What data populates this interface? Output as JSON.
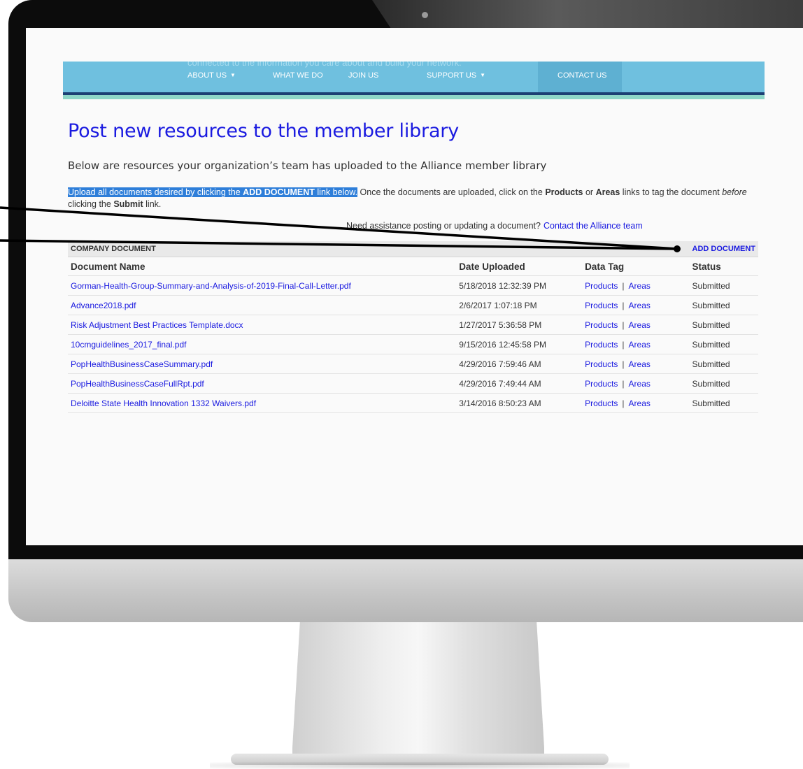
{
  "nav": {
    "tagline": "connected to the information you care about and build your network.",
    "items": [
      {
        "label": "ABOUT US",
        "arrow": "▼"
      },
      {
        "label": "WHAT WE DO"
      },
      {
        "label": "JOIN US"
      },
      {
        "label": "SUPPORT US",
        "arrow": "▼"
      },
      {
        "label": "CONTACT US"
      }
    ]
  },
  "page": {
    "title": "Post new resources to the member library",
    "subtitle": "Below are resources your organization’s team has uploaded to the Alliance member library",
    "instructions": {
      "highlight_pre": "Upload all documents desired by clicking the ",
      "highlight_bold": "ADD DOCUMENT",
      "highlight_post": " link below.",
      "text1": " Once the documents are uploaded, click on the ",
      "products": "Products",
      "or": " or ",
      "areas": "Areas",
      "text2": " links to tag the document ",
      "before": "before",
      "line2_pre": "clicking the ",
      "submit": "Submit",
      "line2_post": " link."
    },
    "assist_text": "Need assistance posting or updating a document?",
    "assist_link": "Contact the Alliance team"
  },
  "table": {
    "bar_label": "COMPANY DOCUMENT",
    "add_label": "ADD DOCUMENT",
    "headers": {
      "name": "Document Name",
      "date": "Date Uploaded",
      "tag": "Data Tag",
      "status": "Status"
    },
    "tag_products": "Products",
    "tag_sep": "|",
    "tag_areas": "Areas",
    "rows": [
      {
        "name": "Gorman-Health-Group-Summary-and-Analysis-of-2019-Final-Call-Letter.pdf",
        "date": "5/18/2018 12:32:39 PM",
        "status": "Submitted"
      },
      {
        "name": "Advance2018.pdf",
        "date": "2/6/2017 1:07:18 PM",
        "status": "Submitted"
      },
      {
        "name": "Risk Adjustment Best Practices Template.docx",
        "date": "1/27/2017 5:36:58 PM",
        "status": "Submitted"
      },
      {
        "name": "10cmguidelines_2017_final.pdf",
        "date": "9/15/2016 12:45:58 PM",
        "status": "Submitted"
      },
      {
        "name": "PopHealthBusinessCaseSummary.pdf",
        "date": "4/29/2016 7:59:46 AM",
        "status": "Submitted"
      },
      {
        "name": "PopHealthBusinessCaseFullRpt.pdf",
        "date": "4/29/2016 7:49:44 AM",
        "status": "Submitted"
      },
      {
        "name": "Deloitte State Health Innovation 1332 Waivers.pdf",
        "date": "3/14/2016 8:50:23 AM",
        "status": "Submitted"
      }
    ]
  },
  "colors": {
    "link": "#1a1ae0",
    "nav": "#6fc0df",
    "nav_active": "#5eb0d2",
    "highlight": "#2e7ed9"
  }
}
